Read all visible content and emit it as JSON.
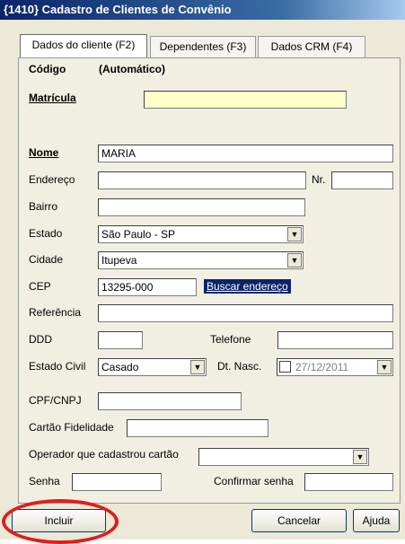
{
  "window": {
    "title": "{1410} Cadastro de Clientes de Convênio"
  },
  "tabs": [
    {
      "label": "Dados do cliente (F2)"
    },
    {
      "label": "Dependentes (F3)"
    },
    {
      "label": "Dados CRM (F4)"
    }
  ],
  "form": {
    "codigo_label": "Código",
    "codigo_value": "(Automático)",
    "matricula_label": "Matrícula",
    "matricula_value": "",
    "nome_label": "Nome",
    "nome_value": "MARIA",
    "endereco_label": "Endereço",
    "endereco_value": "",
    "nr_label": "Nr.",
    "nr_value": "",
    "bairro_label": "Bairro",
    "bairro_value": "",
    "estado_label": "Estado",
    "estado_value": "São Paulo - SP",
    "cidade_label": "Cidade",
    "cidade_value": "Itupeva",
    "cep_label": "CEP",
    "cep_value": "13295-000",
    "buscar_label": "Buscar endereço",
    "referencia_label": "Referência",
    "referencia_value": "",
    "ddd_label": "DDD",
    "ddd_value": "",
    "telefone_label": "Telefone",
    "telefone_value": "",
    "estado_civil_label": "Estado Civil",
    "estado_civil_value": "Casado",
    "dt_nasc_label": "Dt. Nasc.",
    "dt_nasc_value": "27/12/2011",
    "cpf_label": "CPF/CNPJ",
    "cpf_value": "",
    "cartao_label": "Cartão Fidelidade",
    "cartao_value": "",
    "operador_label": "Operador que cadastrou cartão",
    "operador_value": "",
    "senha_label": "Senha",
    "senha_value": "",
    "confirmar_label": "Confirmar senha",
    "confirmar_value": ""
  },
  "buttons": {
    "incluir": "Incluir",
    "cancelar": "Cancelar",
    "ajuda": "Ajuda"
  },
  "colors": {
    "highlight_ring": "#e21d1d",
    "required_field": "#ffffc8",
    "link_bg": "#0a246a"
  }
}
